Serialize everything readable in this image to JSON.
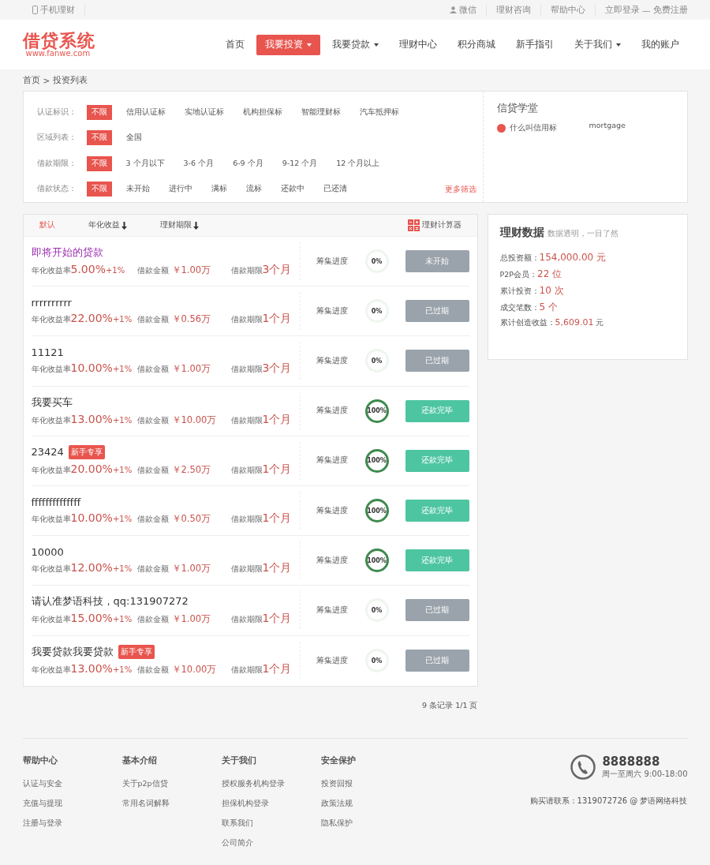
{
  "top_bar": {
    "mobile": "手机理财",
    "links": [
      {
        "label": "微信",
        "icon": true
      },
      {
        "label": "理财咨询",
        "icon": false
      },
      {
        "label": "帮助中心",
        "icon": false
      }
    ],
    "login": "立即登录",
    "separator": "—",
    "register": "免费注册"
  },
  "logo": {
    "title": "借贷系统",
    "url": "www.fanwe.com"
  },
  "nav": [
    {
      "label": "首页",
      "selected": false,
      "dropdown": false
    },
    {
      "label": "我要投资",
      "selected": true,
      "dropdown": true
    },
    {
      "label": "我要贷款",
      "selected": false,
      "dropdown": true
    },
    {
      "label": "理财中心",
      "selected": false,
      "dropdown": false
    },
    {
      "label": "积分商城",
      "selected": false,
      "dropdown": false
    },
    {
      "label": "新手指引",
      "selected": false,
      "dropdown": false
    },
    {
      "label": "关于我们",
      "selected": false,
      "dropdown": true
    },
    {
      "label": "我的账户",
      "selected": false,
      "dropdown": false
    }
  ],
  "breadcrumb": [
    "首页",
    ">",
    "投资列表"
  ],
  "filters": [
    {
      "label": "认证标识：",
      "options": [
        {
          "label": "不限",
          "selected": true
        },
        {
          "label": "信用认证标",
          "selected": false
        },
        {
          "label": "实地认证标",
          "selected": false
        },
        {
          "label": "机构担保标",
          "selected": false
        },
        {
          "label": "智能理财标",
          "selected": false
        },
        {
          "label": "汽车抵押标",
          "selected": false
        }
      ]
    },
    {
      "label": "区域列表：",
      "options": [
        {
          "label": "不限",
          "selected": true
        },
        {
          "label": "全国",
          "selected": false
        }
      ]
    },
    {
      "label": "借款期限：",
      "options": [
        {
          "label": "不限",
          "selected": true
        },
        {
          "label": "3 个月以下",
          "selected": false
        },
        {
          "label": "3-6 个月",
          "selected": false
        },
        {
          "label": "6-9 个月",
          "selected": false
        },
        {
          "label": "9-12 个月",
          "selected": false
        },
        {
          "label": "12 个月以上",
          "selected": false
        }
      ]
    },
    {
      "label": "借款状态：",
      "options": [
        {
          "label": "不限",
          "selected": true
        },
        {
          "label": "未开始",
          "selected": false
        },
        {
          "label": "进行中",
          "selected": false
        },
        {
          "label": "满标",
          "selected": false
        },
        {
          "label": "流标",
          "selected": false
        },
        {
          "label": "还款中",
          "selected": false
        },
        {
          "label": "已还清",
          "selected": false
        }
      ]
    }
  ],
  "more_filters": "更多筛选",
  "school": {
    "title": "信贷学堂",
    "items": [
      {
        "label": "什么叫信用标",
        "note": "mortgage"
      }
    ]
  },
  "sort_tabs": [
    {
      "label": "默认",
      "selected": true,
      "arrow": false
    },
    {
      "label": "年化收益",
      "selected": false,
      "arrow": true
    },
    {
      "label": "理财期限",
      "selected": false,
      "arrow": true
    }
  ],
  "calculator": "理财计算器",
  "loans": [
    {
      "title": "即将开始的贷款",
      "color": "#9b2fae",
      "rate_label": "年化收益率",
      "rate": "5.00%",
      "bonus": "+1%",
      "amount_label": "借款金额",
      "amount": "￥1.00万",
      "term_label": "借款期限",
      "term": "3个月",
      "progress_label": "筹集进度",
      "progress": "0%",
      "status": "未开始",
      "kind": "pending"
    },
    {
      "title": "rrrrrrrrrr",
      "color": "#333333",
      "rate_label": "年化收益率",
      "rate": "22.00%",
      "bonus": "+1%",
      "amount_label": "借款金额",
      "amount": "￥0.56万",
      "term_label": "借款期限",
      "term": "1个月",
      "progress_label": "筹集进度",
      "progress": "0%",
      "status": "已过期",
      "kind": "expired"
    },
    {
      "title": "11121",
      "color": "#333333",
      "rate_label": "年化收益率",
      "rate": "10.00%",
      "bonus": "+1%",
      "amount_label": "借款金额",
      "amount": "￥1.00万",
      "term_label": "借款期限",
      "term": "3个月",
      "progress_label": "筹集进度",
      "progress": "0%",
      "status": "已过期",
      "kind": "expired"
    },
    {
      "title": "我要买车",
      "color": "#333333",
      "rate_label": "年化收益率",
      "rate": "13.00%",
      "bonus": "+1%",
      "amount_label": "借款金额",
      "amount": "￥10.00万",
      "term_label": "借款期限",
      "term": "1个月",
      "progress_label": "筹集进度",
      "progress": "100%",
      "status": "还款完毕",
      "kind": "repaid"
    },
    {
      "title": "23424",
      "color": "#333333",
      "badge": "新手专享",
      "rate_label": "年化收益率",
      "rate": "20.00%",
      "bonus": "+1%",
      "amount_label": "借款金额",
      "amount": "￥2.50万",
      "term_label": "借款期限",
      "term": "1个月",
      "progress_label": "筹集进度",
      "progress": "100%",
      "status": "还款完毕",
      "kind": "repaid"
    },
    {
      "title": "ffffffffffffff",
      "color": "#333333",
      "rate_label": "年化收益率",
      "rate": "10.00%",
      "bonus": "+1%",
      "amount_label": "借款金额",
      "amount": "￥0.50万",
      "term_label": "借款期限",
      "term": "1个月",
      "progress_label": "筹集进度",
      "progress": "100%",
      "status": "还款完毕",
      "kind": "repaid"
    },
    {
      "title": "10000",
      "color": "#333333",
      "rate_label": "年化收益率",
      "rate": "12.00%",
      "bonus": "+1%",
      "amount_label": "借款金额",
      "amount": "￥1.00万",
      "term_label": "借款期限",
      "term": "1个月",
      "progress_label": "筹集进度",
      "progress": "100%",
      "status": "还款完毕",
      "kind": "repaid"
    },
    {
      "title": "请认准梦语科技，qq:131907272",
      "color": "#333333",
      "rate_label": "年化收益率",
      "rate": "15.00%",
      "bonus": "+1%",
      "amount_label": "借款金额",
      "amount": "￥1.00万",
      "term_label": "借款期限",
      "term": "1个月",
      "progress_label": "筹集进度",
      "progress": "0%",
      "status": "已过期",
      "kind": "expired"
    },
    {
      "title": "我要贷款我要贷款",
      "color": "#333333",
      "badge": "新手专享",
      "rate_label": "年化收益率",
      "rate": "13.00%",
      "bonus": "+1%",
      "amount_label": "借款金额",
      "amount": "￥10.00万",
      "term_label": "借款期限",
      "term": "1个月",
      "progress_label": "筹集进度",
      "progress": "0%",
      "status": "已过期",
      "kind": "expired"
    }
  ],
  "pagination": "9 条记录 1/1 页",
  "stats": {
    "title": "理财数据",
    "subtitle": "数据透明，一目了然",
    "items": [
      {
        "label": "总投资额：",
        "value": "154,000.00 元",
        "big": true
      },
      {
        "label": "P2P会员：",
        "value": "22 位",
        "big": true
      },
      {
        "label": "累计投资：",
        "value": "10 次",
        "big": true
      },
      {
        "label": "成交笔数：",
        "value": "5 个",
        "big": true
      },
      {
        "label": "累计创造收益：",
        "value": "5,609.01",
        "unit": "元",
        "big": false
      }
    ]
  },
  "footer": {
    "columns": [
      {
        "title": "帮助中心",
        "links": [
          "认证与安全",
          "充值与提现",
          "注册与登录"
        ]
      },
      {
        "title": "基本介绍",
        "links": [
          "关于p2p信贷",
          "常用名词解释"
        ]
      },
      {
        "title": "关于我们",
        "links": [
          "授权服务机构登录",
          "担保机构登录",
          "联系我们",
          "公司简介"
        ]
      },
      {
        "title": "安全保护",
        "links": [
          "投资回报",
          "政策法规",
          "隐私保护"
        ]
      }
    ],
    "phone": "8888888",
    "hours": "周一至周六 9:00-18:00",
    "contact": "购买请联系：1319072726 @ 梦语网络科技"
  }
}
